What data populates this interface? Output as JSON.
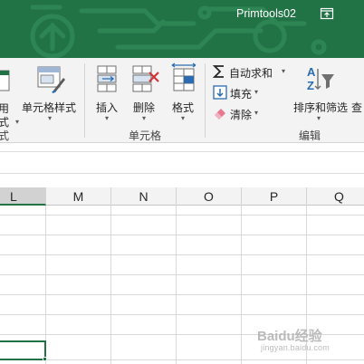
{
  "window": {
    "user_name": "Primtools02",
    "title_bar_color": "#217346"
  },
  "ribbon": {
    "clipped_left": {
      "label_top": "用",
      "label_mid": "式",
      "caret": "▾",
      "group_label_fragment": "式"
    },
    "styles": {
      "cell_styles_label": "单元格样式",
      "caret": "▾"
    },
    "cells_group": {
      "insert_label": "插入",
      "delete_label": "删除",
      "format_label": "格式",
      "caret": "▾",
      "group_label": "单元格"
    },
    "editing_group": {
      "autosum_label": "自动求和",
      "fill_label": "填充",
      "clear_label": "清除",
      "sort_filter_label": "排序和筛选",
      "find_select_label_fragment": "查",
      "caret": "▾",
      "group_label": "编辑"
    }
  },
  "sheet": {
    "columns": [
      "L",
      "M",
      "N",
      "O",
      "P",
      "Q"
    ],
    "selected_column": "L",
    "accent_color": "#217346"
  },
  "watermark": {
    "brand": "Baidu经验",
    "url": "jingyan.baidu.com"
  }
}
